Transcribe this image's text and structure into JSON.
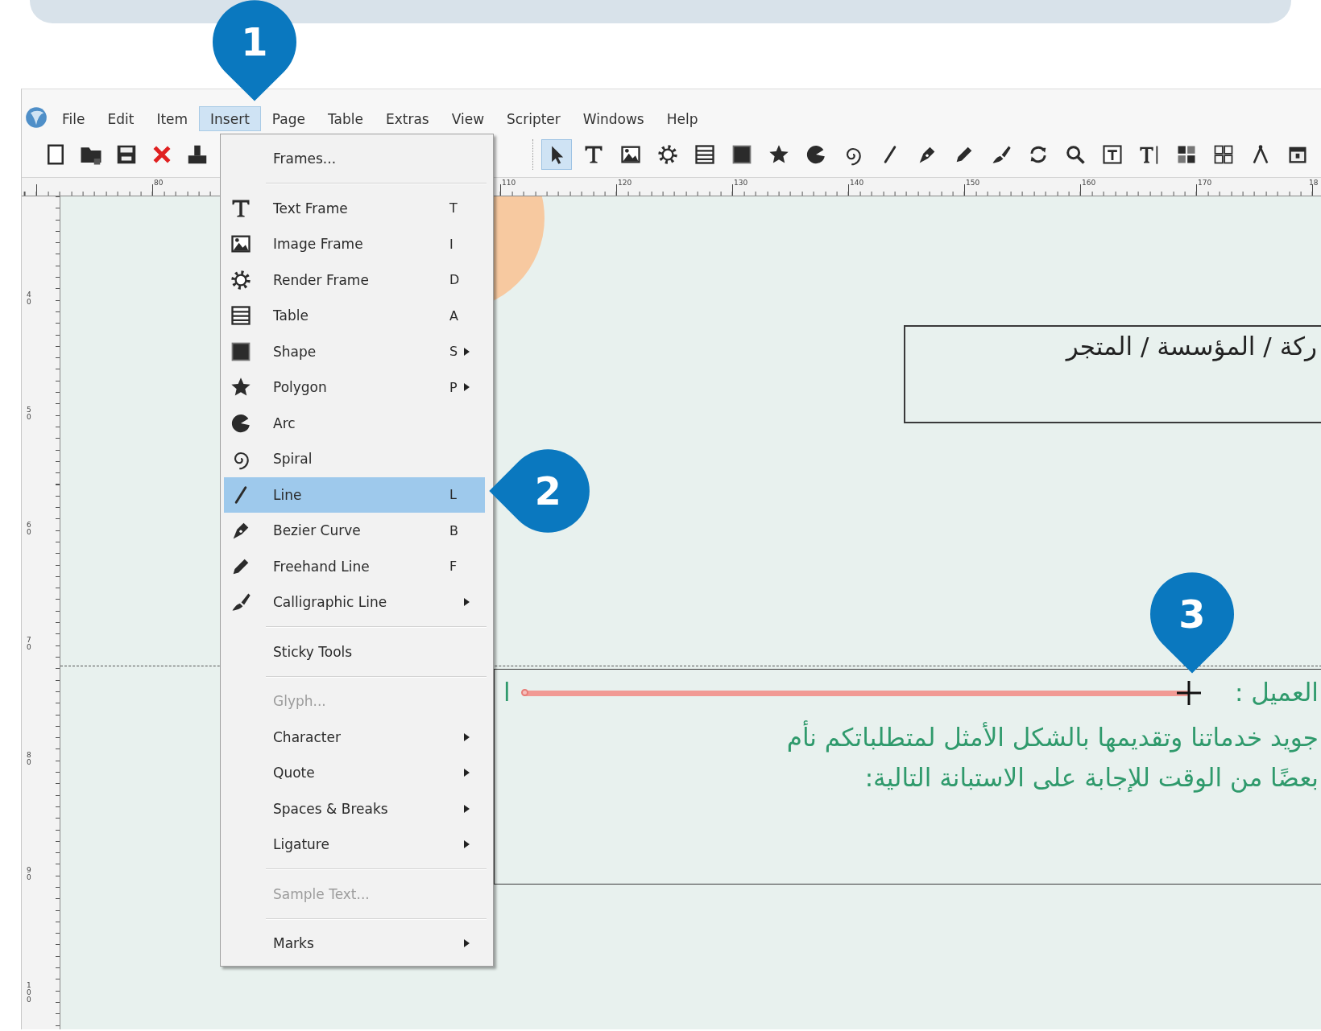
{
  "callouts": [
    {
      "label": "1"
    },
    {
      "label": "2"
    },
    {
      "label": "3"
    }
  ],
  "menu_bar": [
    {
      "label": "File",
      "selected": false
    },
    {
      "label": "Edit",
      "selected": false
    },
    {
      "label": "Item",
      "selected": false
    },
    {
      "label": "Insert",
      "selected": true
    },
    {
      "label": "Page",
      "selected": false
    },
    {
      "label": "Table",
      "selected": false
    },
    {
      "label": "Extras",
      "selected": false
    },
    {
      "label": "View",
      "selected": false
    },
    {
      "label": "Scripter",
      "selected": false
    },
    {
      "label": "Windows",
      "selected": false
    },
    {
      "label": "Help",
      "selected": false
    }
  ],
  "toolbar_right": [
    {
      "selected": true
    },
    {
      "selected": false
    },
    {
      "selected": false
    },
    {
      "selected": false
    },
    {
      "selected": false
    },
    {
      "selected": false
    },
    {
      "selected": false
    },
    {
      "selected": false
    },
    {
      "selected": false
    },
    {
      "selected": false
    },
    {
      "selected": false
    },
    {
      "selected": false
    },
    {
      "selected": false
    },
    {
      "selected": false
    },
    {
      "selected": false
    },
    {
      "selected": false
    },
    {
      "selected": false
    },
    {
      "selected": false
    },
    {
      "selected": false
    },
    {
      "selected": false
    },
    {
      "selected": false
    }
  ],
  "top_ruler": [
    "80",
    "110",
    "120",
    "130",
    "140",
    "150",
    "160",
    "170",
    "18"
  ],
  "left_ruler": [
    "40",
    "50",
    "60",
    "70",
    "80",
    "90",
    "100"
  ],
  "insert_menu": {
    "items": [
      {
        "kind": "item",
        "label": "Frames...",
        "selected": false,
        "disabled": false,
        "submenu": false
      },
      {
        "kind": "separator"
      },
      {
        "kind": "item",
        "label": "Text Frame",
        "shortcut": "T",
        "selected": false,
        "disabled": false,
        "submenu": false
      },
      {
        "kind": "item",
        "label": "Image Frame",
        "shortcut": "I",
        "selected": false,
        "disabled": false,
        "submenu": false
      },
      {
        "kind": "item",
        "label": "Render Frame",
        "shortcut": "D",
        "selected": false,
        "disabled": false,
        "submenu": false
      },
      {
        "kind": "item",
        "label": "Table",
        "shortcut": "A",
        "selected": false,
        "disabled": false,
        "submenu": false
      },
      {
        "kind": "item",
        "label": "Shape",
        "shortcut": "S",
        "selected": false,
        "disabled": false,
        "submenu": true
      },
      {
        "kind": "item",
        "label": "Polygon",
        "shortcut": "P",
        "selected": false,
        "disabled": false,
        "submenu": true
      },
      {
        "kind": "item",
        "label": "Arc",
        "selected": false,
        "disabled": false,
        "submenu": false
      },
      {
        "kind": "item",
        "label": "Spiral",
        "selected": false,
        "disabled": false,
        "submenu": false
      },
      {
        "kind": "item",
        "label": "Line",
        "shortcut": "L",
        "selected": true,
        "disabled": false,
        "submenu": false
      },
      {
        "kind": "item",
        "label": "Bezier Curve",
        "shortcut": "B",
        "selected": false,
        "disabled": false,
        "submenu": false
      },
      {
        "kind": "item",
        "label": "Freehand Line",
        "shortcut": "F",
        "selected": false,
        "disabled": false,
        "submenu": false
      },
      {
        "kind": "item",
        "label": "Calligraphic Line",
        "selected": false,
        "disabled": false,
        "submenu": true
      },
      {
        "kind": "separator"
      },
      {
        "kind": "item",
        "label": "Sticky Tools",
        "selected": false,
        "disabled": false,
        "submenu": false
      },
      {
        "kind": "separator"
      },
      {
        "kind": "item",
        "label": "Glyph...",
        "selected": false,
        "disabled": true,
        "submenu": false
      },
      {
        "kind": "item",
        "label": "Character",
        "selected": false,
        "disabled": false,
        "submenu": true
      },
      {
        "kind": "item",
        "label": "Quote",
        "selected": false,
        "disabled": false,
        "submenu": true
      },
      {
        "kind": "item",
        "label": "Spaces & Breaks",
        "selected": false,
        "disabled": false,
        "submenu": true
      },
      {
        "kind": "item",
        "label": "Ligature",
        "selected": false,
        "disabled": false,
        "submenu": true
      },
      {
        "kind": "separator"
      },
      {
        "kind": "item",
        "label": "Sample Text...",
        "selected": false,
        "disabled": true,
        "submenu": false
      },
      {
        "kind": "separator"
      },
      {
        "kind": "item",
        "label": "Marks",
        "selected": false,
        "disabled": false,
        "submenu": true
      }
    ]
  },
  "canvas": {
    "header_frame_text": "ركة / المؤسسة / المتجر",
    "body_fragment": "ا",
    "body_label": "العميل :",
    "body_lines": [
      "جويد خدماتنا وتقديمها بالشكل الأمثل لمتطلباتكم نأم",
      "بعضًا من الوقت للإجابة على الاستبانة التالية:"
    ]
  }
}
